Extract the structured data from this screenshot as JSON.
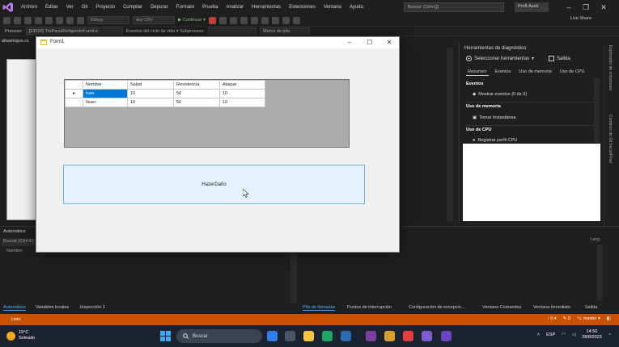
{
  "menubar": {
    "items": [
      "Archivo",
      "Editar",
      "Ver",
      "Git",
      "Proyecto",
      "Compilar",
      "Depurar",
      "Formato",
      "Prueba",
      "Analizar",
      "Herramientas",
      "Extensiones",
      "Ventana",
      "Ayuda"
    ],
    "search_placeholder": "Buscar (Ctrl+Q)",
    "profile": "Proft.Aseti"
  },
  "toolbar": {
    "config_combo": "Debug",
    "platform_combo": "Any CPU",
    "continue_label": "▶ Continuar ▾",
    "live_share": "Live Share"
  },
  "processbar": {
    "label": "Proceso:",
    "process": "[13010] TrePaciaRefajendeFuent.e",
    "events": "Eventos del ciclo de vida ▾ Subproceso:",
    "frame": "Marco de pila"
  },
  "doc_tab": "altaamigos.cs",
  "diagnostics": {
    "title": "Herramientas de diagnóstico",
    "select_tools": "Seleccionar herramientas",
    "output": "Salida",
    "tabs": [
      "Resumen",
      "Eventos",
      "Uso de memoria",
      "Uso de CPU"
    ],
    "sections": [
      {
        "title": "Eventos",
        "item": "Mostrar eventos (0 de 0)"
      },
      {
        "title": "Uso de memoria",
        "item": "Tomar instantánea"
      },
      {
        "title": "Uso de CPU",
        "item": "Registrar perfil CPU"
      }
    ],
    "side_tabs": [
      "Explorador de soluciones",
      "Cambios de Git  Inicio/Final"
    ]
  },
  "autos": {
    "title": "Automático",
    "search": "Buscar (Ctrl+E)",
    "column": "Nombre"
  },
  "callstack": {
    "column": "Leng"
  },
  "bottom_tabs": {
    "left": [
      "Automático",
      "Variables locales",
      "Inspección 1"
    ],
    "right": [
      "Pila de llamadas",
      "Puntos de interrupción",
      "Configuración de excepcio...",
      "Ventana Comandos",
      "Ventana Inmediato",
      "Salida"
    ]
  },
  "statusbar": {
    "ready": "Listo",
    "right": [
      "↑ 0 ▾",
      "✎ 0",
      "⌥ master ▾",
      "◧"
    ]
  },
  "taskbar": {
    "weather_temp": "19°C",
    "weather_desc": "Soleado",
    "search": "Buscar",
    "lang": "ESP",
    "time": "14:50",
    "date": "28/8/2023"
  },
  "form1": {
    "title": "Form1",
    "grid": {
      "columns": [
        "Nombre",
        "Salud",
        "Resistencia",
        "Ataque"
      ],
      "rows": [
        {
          "marker": "▸",
          "cells": [
            "Ivan",
            "10",
            "50",
            "10"
          ]
        },
        {
          "marker": "",
          "cells": [
            "Ilean",
            "10",
            "50",
            "10"
          ]
        }
      ]
    },
    "button_label": "HazerDaño"
  },
  "colors": {
    "status_accent": "#ca5100",
    "selection": "#0078d7",
    "button_fill": "#e5f1fb"
  }
}
